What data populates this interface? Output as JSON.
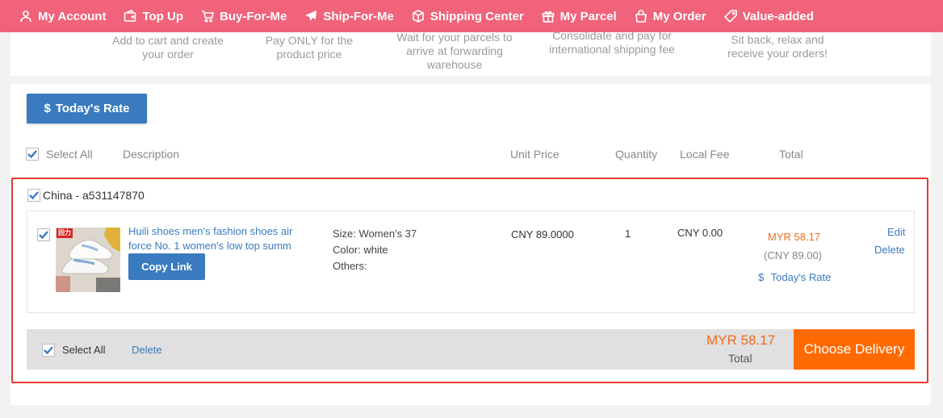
{
  "nav": {
    "items": [
      {
        "label": "My Account",
        "icon": "user-icon"
      },
      {
        "label": "Top Up",
        "icon": "wallet-icon"
      },
      {
        "label": "Buy-For-Me",
        "icon": "cart-icon"
      },
      {
        "label": "Ship-For-Me",
        "icon": "plane-icon"
      },
      {
        "label": "Shipping Center",
        "icon": "box-icon"
      },
      {
        "label": "My Parcel",
        "icon": "gift-icon"
      },
      {
        "label": "My Order",
        "icon": "bag-icon"
      },
      {
        "label": "Value-added",
        "icon": "tag-icon"
      }
    ]
  },
  "steps": [
    {
      "text": "Add to cart and create your order"
    },
    {
      "text": "Pay ONLY for the product price"
    },
    {
      "text": "Wait for your parcels to arrive at forwarding warehouse"
    },
    {
      "text": "Consolidate and pay for international shipping fee"
    },
    {
      "text": "Sit back, relax and receive your orders!"
    }
  ],
  "rate_button": {
    "icon": "$",
    "label": "Today's Rate"
  },
  "table_header": {
    "select_all": "Select All",
    "description": "Description",
    "unit_price": "Unit Price",
    "quantity": "Quantity",
    "local_fee": "Local Fee",
    "total": "Total"
  },
  "group": {
    "title": "China - a531147870",
    "checked": true
  },
  "item": {
    "checked": true,
    "thumb_badge": "回力",
    "title": "Huili shoes men's fashion shoes air force No. 1 women's low top summ",
    "copy_link": "Copy Link",
    "size_label": "Size:",
    "size_value": "Women's 37",
    "color_label": "Color:",
    "color_value": "white",
    "others_label": "Others:",
    "unit_price": "CNY 89.0000",
    "quantity": "1",
    "local_fee": "CNY 0.00",
    "total_myr": "MYR 58.17",
    "total_cny": "(CNY 89.00)",
    "rate_link_icon": "$",
    "rate_link": "Today's Rate",
    "edit": "Edit",
    "delete": "Delete"
  },
  "footer": {
    "select_all": "Select All",
    "delete": "Delete",
    "total_amount": "MYR 58.17",
    "total_label": "Total",
    "choose_delivery": "Choose Delivery"
  },
  "colors": {
    "nav_bg": "#f0637a",
    "primary_blue": "#3a7bbf",
    "accent_orange": "#ff6a00",
    "highlight_red": "#e53935"
  }
}
